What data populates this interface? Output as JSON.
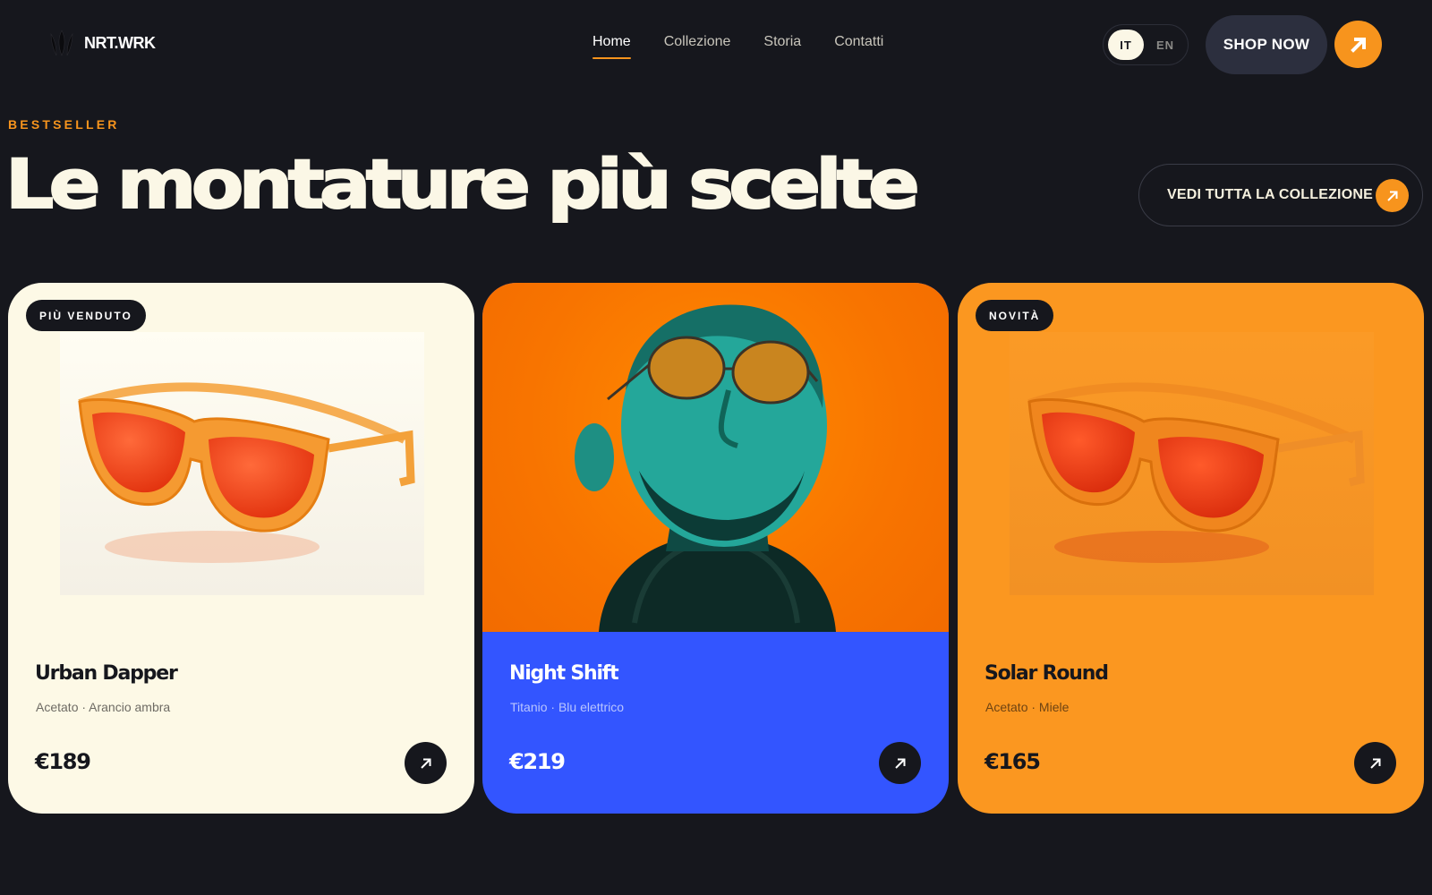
{
  "header": {
    "logo_text": "NRT.WRK",
    "nav": [
      {
        "label": "Home",
        "active": true
      },
      {
        "label": "Collezione",
        "active": false
      },
      {
        "label": "Storia",
        "active": false
      },
      {
        "label": "Contatti",
        "active": false
      }
    ],
    "languages": [
      {
        "label": "IT",
        "active": true
      },
      {
        "label": "EN",
        "active": false
      }
    ],
    "shop_now_label": "SHOP NOW"
  },
  "hero": {
    "eyebrow": "BESTSELLER",
    "title": "Le montature più scelte",
    "view_all_label": "VEDI TUTTA LA COLLEZIONE"
  },
  "products": [
    {
      "badge": "PIÙ VENDUTO",
      "name": "Urban Dapper",
      "details": "Acetato · Arancio ambra",
      "price": "€189"
    },
    {
      "badge": "",
      "name": "Night Shift",
      "details": "Titanio · Blu elettrico",
      "price": "€219"
    },
    {
      "badge": "NOVITÀ",
      "name": "Solar Round",
      "details": "Acetato · Miele",
      "price": "€165"
    }
  ],
  "icons": {
    "logo": "leaf-logo-icon",
    "arrow": "arrow-up-right-icon"
  },
  "colors": {
    "background": "#16171d",
    "accent": "#f7941d",
    "card_cream": "#fdf9e6",
    "card_blue": "#3355ff",
    "card_orange": "#fb9720"
  }
}
